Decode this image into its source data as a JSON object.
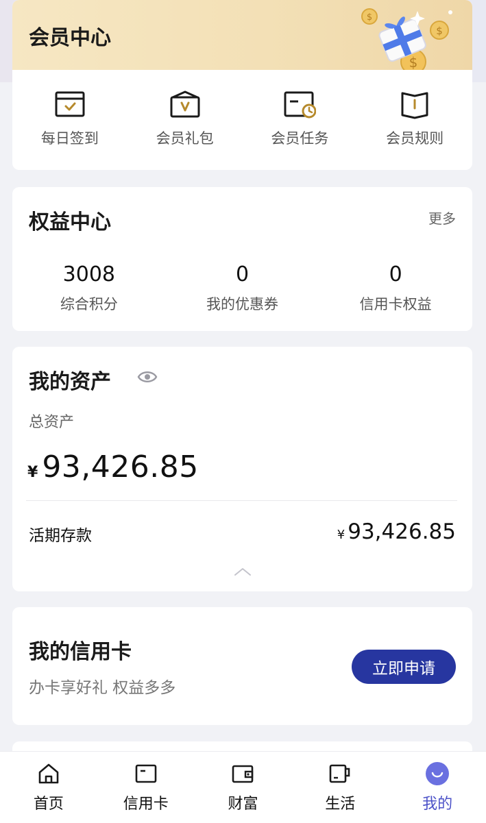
{
  "member": {
    "title": "会员中心",
    "features": [
      {
        "label": "每日签到",
        "icon": "calendar-check-icon"
      },
      {
        "label": "会员礼包",
        "icon": "gift-pack-icon"
      },
      {
        "label": "会员任务",
        "icon": "task-clock-icon"
      },
      {
        "label": "会员规则",
        "icon": "rule-book-icon"
      }
    ]
  },
  "rights": {
    "title": "权益中心",
    "more": "更多",
    "stats": [
      {
        "value": "3008",
        "label": "综合积分"
      },
      {
        "value": "0",
        "label": "我的优惠券"
      },
      {
        "value": "0",
        "label": "信用卡权益"
      }
    ]
  },
  "assets": {
    "title": "我的资产",
    "total_label": "总资产",
    "currency": "¥",
    "total_amount": "93,426.85",
    "deposit_label": "活期存款",
    "deposit_amount": "93,426.85"
  },
  "credit": {
    "title": "我的信用卡",
    "subtitle": "办卡享好礼 权益多多",
    "apply": "立即申请"
  },
  "nav": [
    {
      "label": "首页",
      "icon": "home-icon"
    },
    {
      "label": "信用卡",
      "icon": "card-icon"
    },
    {
      "label": "财富",
      "icon": "wallet-icon"
    },
    {
      "label": "生活",
      "icon": "cup-icon"
    },
    {
      "label": "我的",
      "icon": "profile-icon",
      "active": true
    }
  ],
  "colors": {
    "accent": "#2736a0",
    "gold": "#b68a2c",
    "nav_active": "#4c52c8",
    "member_banner": "#f3e0b6"
  }
}
